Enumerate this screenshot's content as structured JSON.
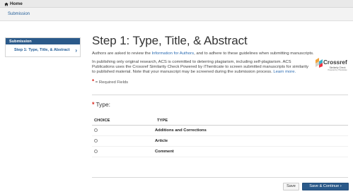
{
  "topbar": {
    "home_label": "Home",
    "home_icon": "home-icon"
  },
  "subbar": {
    "title": "Submission"
  },
  "sidebar": {
    "heading": "Submission",
    "items": [
      {
        "label": "Step 1: Type, Title, & Abstract",
        "icon": "chevron-right-icon"
      }
    ]
  },
  "main": {
    "title": "Step 1: Type, Title, & Abstract",
    "intro_prefix": "Authors are asked to review the ",
    "intro_link": "Information for Authors",
    "intro_suffix": ", and to adhere to these guidelines when submitting manuscripts.",
    "plagiarism_text": "In publishing only original research, ACS is committed to deterring plagiarism, including self-plagiarism. ACS Publications uses the Crossref Similarity Check Powered by iThenticate to screen submitted manuscripts for similarity to published material. Note that your manuscript may be screened during the submission process. ",
    "learn_more": "Learn more.",
    "crossref": {
      "name": "Crossref",
      "sub": "Similarity Check",
      "sub2": "Powered by iThenticate"
    },
    "required_star": "*",
    "required_text": "= Required Fields"
  },
  "type_section": {
    "label": "Type:",
    "star": "*",
    "columns": [
      "CHOICE",
      "TYPE"
    ],
    "rows": [
      {
        "type": "Additions and Corrections"
      },
      {
        "type": "Article"
      },
      {
        "type": "Comment"
      }
    ]
  },
  "footer": {
    "save_label": "Save",
    "continue_label": "Save & Continue",
    "continue_icon": "chevron-right-icon"
  },
  "colors": {
    "accent": "#2b5a8a",
    "link": "#2a6ab0",
    "required": "#d9261c"
  }
}
